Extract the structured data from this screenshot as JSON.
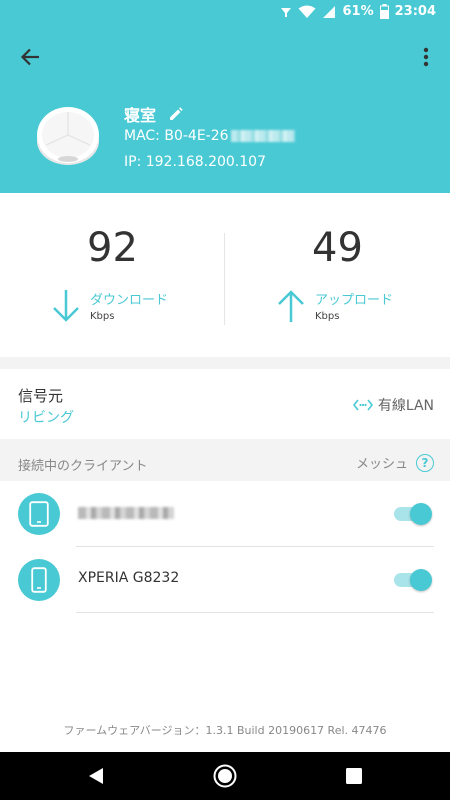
{
  "status_bar": {
    "battery": "61%",
    "time": "23:04"
  },
  "device": {
    "name": "寝室",
    "mac": "MAC: B0-4E-26",
    "ip": "IP: 192.168.200.107"
  },
  "speed": {
    "download": {
      "value": "92",
      "label": "ダウンロード",
      "unit": "Kbps"
    },
    "upload": {
      "value": "49",
      "label": "アップロード",
      "unit": "Kbps"
    }
  },
  "source": {
    "title": "信号元",
    "value": "リビング",
    "connection": "有線LAN"
  },
  "clients": {
    "title": "接続中のクライアント",
    "mesh_label": "メッシュ",
    "items": [
      {
        "name": "",
        "enabled": true
      },
      {
        "name": "XPERIA G8232",
        "enabled": true
      }
    ]
  },
  "firmware": "ファームウェアバージョン：1.3.1 Build 20190617 Rel. 47476",
  "colors": {
    "accent": "#49c9d4",
    "accent_light": "#a8e4ea",
    "band": "#f3f3f3"
  }
}
